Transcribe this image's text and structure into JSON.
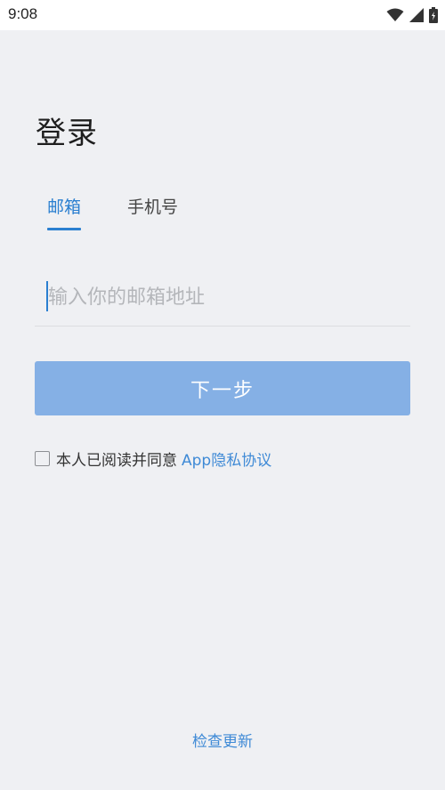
{
  "status_bar": {
    "time": "9:08",
    "icons": [
      "wifi-icon",
      "signal-icon",
      "battery-icon"
    ]
  },
  "login": {
    "title": "登录",
    "tabs": [
      {
        "label": "邮箱",
        "active": true
      },
      {
        "label": "手机号",
        "active": false
      }
    ],
    "email_input": {
      "placeholder": "输入你的邮箱地址",
      "value": ""
    },
    "next_button": "下一步",
    "agreement": {
      "checked": false,
      "text": "本人已阅读并同意",
      "link": "App隐私协议"
    },
    "check_update": "检查更新"
  },
  "colors": {
    "accent": "#2a7fd0",
    "button_disabled": "#85b0e5",
    "background": "#eff0f3"
  }
}
